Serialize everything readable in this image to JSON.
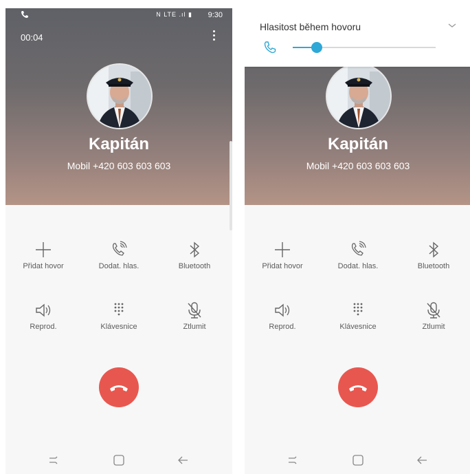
{
  "left_screen": {
    "status_bar": {
      "time": "9:30",
      "icons": "N LTE .ıl ▮"
    },
    "call_timer": "00:04",
    "caller": {
      "name": "Kapitán",
      "number": "Mobil  +420 603 603 603"
    },
    "actions": [
      {
        "label": "Přidat hovor",
        "icon": "plus-icon"
      },
      {
        "label": "Dodat. hlas.",
        "icon": "phone-volume-icon"
      },
      {
        "label": "Bluetooth",
        "icon": "bluetooth-icon"
      },
      {
        "label": "Reprod.",
        "icon": "speaker-icon"
      },
      {
        "label": "Klávesnice",
        "icon": "keypad-icon"
      },
      {
        "label": "Ztlumit",
        "icon": "mic-mute-icon"
      }
    ]
  },
  "right_screen": {
    "volume_panel": {
      "title": "Hlasitost během hovoru",
      "level_fraction": 0.17
    },
    "caller": {
      "name": "Kapitán",
      "number": "Mobil  +420 603 603 603"
    },
    "actions": [
      {
        "label": "Přidat hovor",
        "icon": "plus-icon"
      },
      {
        "label": "Dodat. hlas.",
        "icon": "phone-volume-icon"
      },
      {
        "label": "Bluetooth",
        "icon": "bluetooth-icon"
      },
      {
        "label": "Reprod.",
        "icon": "speaker-icon"
      },
      {
        "label": "Klávesnice",
        "icon": "keypad-icon"
      },
      {
        "label": "Ztlumit",
        "icon": "mic-mute-icon"
      }
    ]
  },
  "colors": {
    "end_call": "#e8574f",
    "accent": "#2ea8d6",
    "header_top": "#5f6167",
    "header_bottom": "#b49486"
  }
}
